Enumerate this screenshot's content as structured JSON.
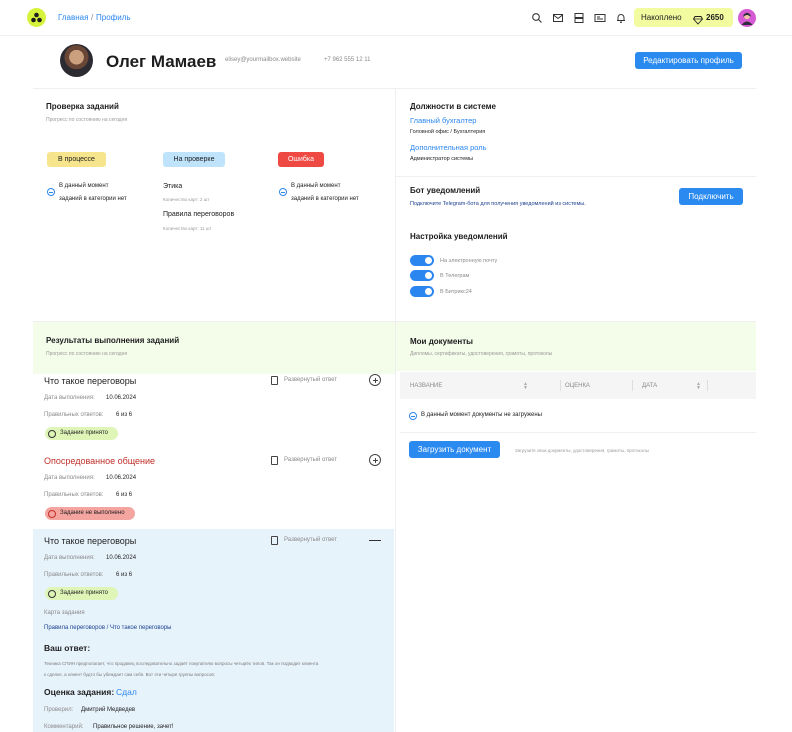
{
  "header": {
    "breadcrumb_home": "Главная",
    "breadcrumb_sep": "/",
    "breadcrumb_current": "Профиль",
    "accumulated_label": "Накоплено",
    "accumulated_value": "2650",
    "icons": [
      "search-icon",
      "mail-icon",
      "server-icon",
      "id-card-icon",
      "bell-icon"
    ]
  },
  "profile": {
    "name": "Олег Мамаев",
    "email": "elisey@yourmailbox.website",
    "phone": "+7 962 555 12 11",
    "edit_button": "Редактировать профиль"
  },
  "task_check": {
    "title": "Проверка заданий",
    "subtitle": "Прогресс по состоянию на сегодня",
    "in_progress_label": "В процессе",
    "in_progress_empty_1": "В данный момент",
    "in_progress_empty_2": "заданий в категории нет",
    "review_label": "На проверке",
    "review_items": [
      {
        "name": "Этика",
        "count": "Количество карт: 2 шт"
      },
      {
        "name": "Правила переговоров",
        "count": "Количество карт: 11 шт"
      }
    ],
    "error_label": "Ошибка",
    "error_empty_1": "В данный момент",
    "error_empty_2": "заданий в категории нет"
  },
  "positions": {
    "title": "Должности в системе",
    "main_role": "Главный бухгалтер",
    "main_role_sub": "Головной офис / Бухгалтерия",
    "extra_role": "Дополнительная роль",
    "extra_role_sub": "Администратор системы"
  },
  "bot": {
    "title": "Бот уведомлений",
    "description": "Подключите Telegram-бота для получения уведомлений из системы.",
    "connect_button": "Подключить"
  },
  "notifications": {
    "title": "Настройка уведомлений",
    "options": [
      "На электронную почту",
      "В Телеграм",
      "В Битрикс24"
    ],
    "enabled": [
      true,
      true,
      true
    ]
  },
  "results": {
    "title": "Результаты выполнения заданий",
    "subtitle": "Прогресс по состоянию на сегодня",
    "date_label": "Дата выполнения:",
    "correct_label": "Правильных ответов:",
    "tasks": [
      {
        "title": "Что такое переговоры",
        "answer_type": "Развернутый ответ",
        "date": "10.06.2024",
        "correct": "6 из 6",
        "status": "Задание принято"
      },
      {
        "title": "Опосредованное общение",
        "answer_type": "Развернутый ответ",
        "date": "10.06.2024",
        "correct": "6 из 6",
        "status": "Задание не выполнено"
      },
      {
        "title": "Что такое переговоры",
        "answer_type": "Развернутый ответ",
        "date": "10.06.2024",
        "correct": "6 из 6",
        "status": "Задание принято"
      }
    ],
    "card_label": "Карта задания",
    "card_path": "Правила переговоров / Что такое переговоры",
    "your_answer_label": "Ваш ответ:",
    "answer_text_1": "Техника СПИН предполагает, что продавец последовательно задаёт покупателю вопросы четырёх типов. Так он подводит клиента",
    "answer_text_2": "к сделке, а клиент будто бы убеждает сам себя. Вот эти четыре группы вопросов:",
    "grade_label": "Оценка задания:",
    "grade_value": "Сдал",
    "reviewer_label": "Проверил:",
    "reviewer_value": "Дмитрий Медведев",
    "comment_label": "Комментарий:",
    "comment_value": "Правильное решение, зачет!"
  },
  "documents": {
    "title": "Мои документы",
    "subtitle": "Дипломы, сертификаты, удостоверения, грамоты, протоколы",
    "col_name": "НАЗВАНИЕ",
    "col_grade": "ОЦЕНКА",
    "col_date": "ДАТА",
    "empty": "В данный момент документы не загружены",
    "upload_button": "Загрузить документ",
    "upload_hint": "Загрузите свои документы, удостоверения, грамоты, протоколы"
  },
  "colors": {
    "accent_blue": "#2b8af0",
    "badge_progress": "#f6e58d",
    "badge_review": "#bfe3fb",
    "badge_error": "#ee4a43",
    "accepted_bg": "#dff5b8",
    "failed_bg": "#f4a59f",
    "lime": "#d7f23b"
  }
}
